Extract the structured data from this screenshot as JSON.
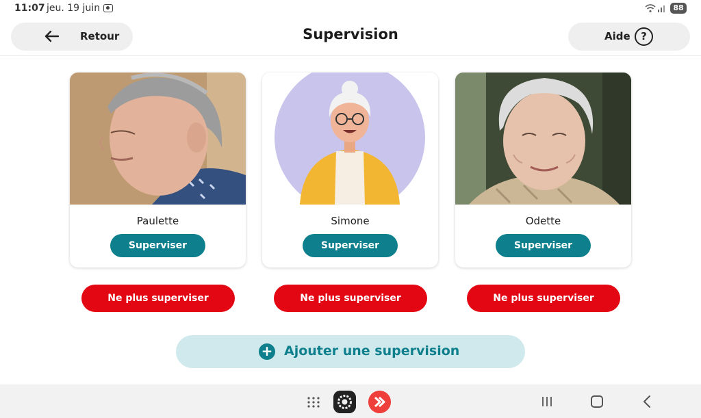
{
  "status_bar": {
    "time": "11:07",
    "date": "jeu. 19 juin",
    "battery": "88"
  },
  "header": {
    "back_label": "Retour",
    "title": "Supervision",
    "help_label": "Aide",
    "help_icon": "?"
  },
  "people": [
    {
      "name": "Paulette",
      "supervise_label": "Superviser",
      "stop_label": "Ne plus superviser",
      "avatar": "photo-woman-grey-hair-profile"
    },
    {
      "name": "Simone",
      "supervise_label": "Superviser",
      "stop_label": "Ne plus superviser",
      "avatar": "illustration-elderly-woman-glasses"
    },
    {
      "name": "Odette",
      "supervise_label": "Superviser",
      "stop_label": "Ne plus superviser",
      "avatar": "photo-elderly-woman-smiling"
    }
  ],
  "add_button": {
    "icon": "+",
    "label": "Ajouter une supervision"
  },
  "colors": {
    "primary": "#0e7f8c",
    "danger": "#e30613",
    "add_bg": "#d0e9ec"
  }
}
